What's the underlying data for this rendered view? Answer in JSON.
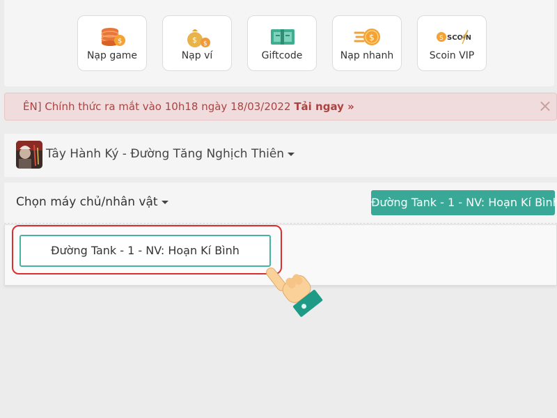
{
  "nav": {
    "items": [
      {
        "label": "Nạp game",
        "icon": "coin-stack-icon"
      },
      {
        "label": "Nạp ví",
        "icon": "money-bag-icon"
      },
      {
        "label": "Giftcode",
        "icon": "gift-ticket-icon"
      },
      {
        "label": "Nạp nhanh",
        "icon": "fast-coin-icon"
      },
      {
        "label": "Scoin VIP",
        "icon": "scoin-vip-icon",
        "logo_text": "SCOIN"
      }
    ]
  },
  "alert": {
    "text": "ÊN] Chính thức ra mắt vào 10h18 ngày 18/03/2022",
    "link": "Tải ngay »",
    "close": "×"
  },
  "game": {
    "title": "Tây Hành Ký - Đường Tăng Nghịch Thiên"
  },
  "server": {
    "label": "Chọn máy chủ/nhân vật",
    "selected": "Đường Tank - 1 - NV: Hoạn Kí Bình",
    "options": [
      "Đường Tank - 1 - NV: Hoạn Kí Bình"
    ]
  },
  "colors": {
    "accent": "#3aa897",
    "alert_text": "#a94442",
    "highlight": "#dc2e2e"
  }
}
